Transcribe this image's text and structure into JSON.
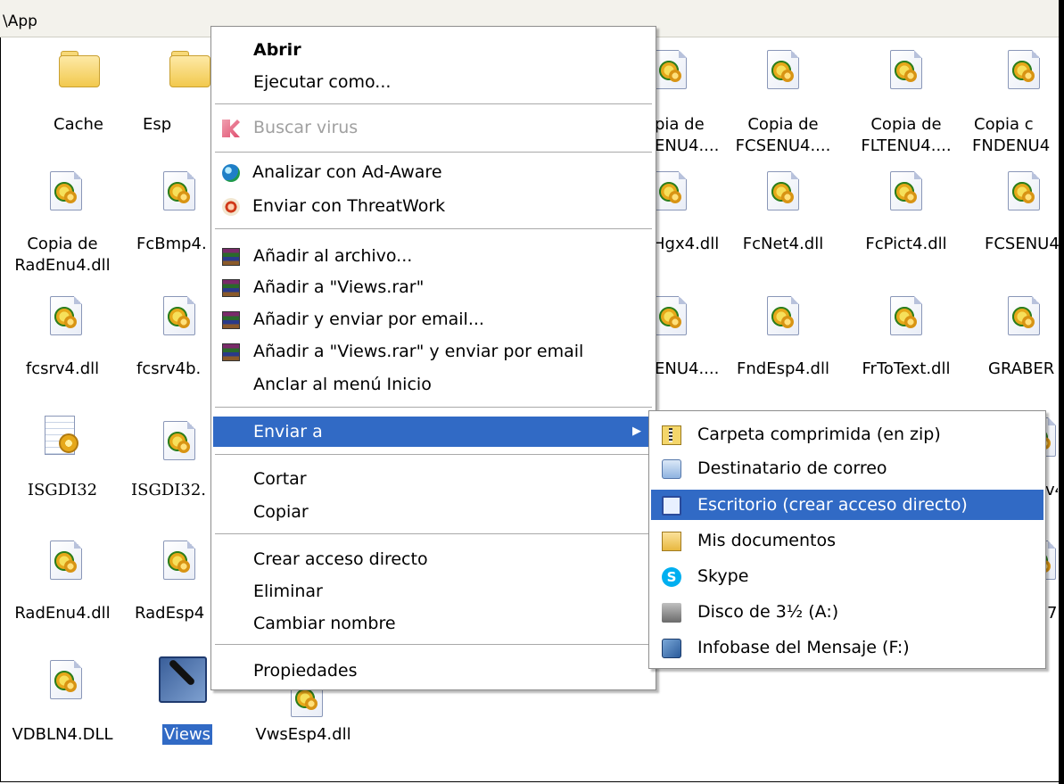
{
  "window": {
    "path": "\\App"
  },
  "icons": [
    {
      "label": "Cache",
      "type": "folder"
    },
    {
      "label": "Esp",
      "type": "folder"
    },
    {
      "label": "Copia de RadEnu4.dll",
      "line1": "Copia de",
      "line2": "RadEnu4.dll",
      "type": "dll"
    },
    {
      "label": "FcBmp4.",
      "type": "dll"
    },
    {
      "label": "fcsrv4.dll",
      "type": "dll"
    },
    {
      "label": "fcsrv4b.",
      "type": "dll"
    },
    {
      "label": "ISGDI32",
      "type": "notepad"
    },
    {
      "label": "ISGDI32.",
      "type": "dll"
    },
    {
      "label": "RadEnu4.dll",
      "type": "dll"
    },
    {
      "label": "RadEsp4",
      "type": "dll"
    },
    {
      "label": "VDBLN4.DLL",
      "type": "dll"
    },
    {
      "label": "Views",
      "type": "views",
      "selected": true
    },
    {
      "label": "VwsEsp4.dll",
      "type": "dll"
    },
    {
      "label": "pia de ENU4....",
      "line1": "pia de",
      "line2": "ENU4....",
      "type": "dll"
    },
    {
      "label": "Copia de FCSENU4....",
      "line1": "Copia de",
      "line2": "FCSENU4....",
      "type": "dll"
    },
    {
      "label": "Copia de FLTENU4....",
      "line1": "Copia de",
      "line2": "FLTENU4....",
      "type": "dll"
    },
    {
      "label": "Copia c FNDENU4",
      "line1": "Copia c",
      "line2": "FNDENU4",
      "type": "dll"
    },
    {
      "label": "Hgx4.dll",
      "type": "dll"
    },
    {
      "label": "FcNet4.dll",
      "type": "dll"
    },
    {
      "label": "FcPict4.dll",
      "type": "dll"
    },
    {
      "label": "FCSENU4",
      "type": "dll"
    },
    {
      "label": "ENU4....",
      "type": "dll"
    },
    {
      "label": "FndEsp4.dll",
      "type": "dll"
    },
    {
      "label": "FrToText.dll",
      "type": "dll"
    },
    {
      "label": "GRABER",
      "type": "dll"
    },
    {
      "label": "v4.",
      "type": "dll"
    },
    {
      "label": "7.",
      "type": "dll"
    }
  ],
  "context_menu": {
    "items": [
      {
        "label": "Abrir",
        "icon": "none",
        "bold": true
      },
      {
        "label": "Ejecutar como...",
        "icon": "none"
      },
      {
        "label": "Buscar virus",
        "icon": "kaspersky-icon",
        "disabled": true
      },
      {
        "label": "Analizar con Ad-Aware",
        "icon": "adaware-icon"
      },
      {
        "label": "Enviar con ThreatWork",
        "icon": "threatwork-icon"
      },
      {
        "label": "Añadir al archivo...",
        "icon": "winrar-icon"
      },
      {
        "label": "Añadir a \"Views.rar\"",
        "icon": "winrar-icon"
      },
      {
        "label": "Añadir y enviar por email...",
        "icon": "winrar-icon"
      },
      {
        "label": "Añadir a \"Views.rar\" y enviar por email",
        "icon": "winrar-icon"
      },
      {
        "label": "Anclar al menú Inicio",
        "icon": "none"
      },
      {
        "label": "Enviar a",
        "icon": "none",
        "highlighted": true,
        "submenu_arrow": "▶"
      },
      {
        "label": "Cortar",
        "icon": "none"
      },
      {
        "label": "Copiar",
        "icon": "none"
      },
      {
        "label": "Crear acceso directo",
        "icon": "none"
      },
      {
        "label": "Eliminar",
        "icon": "none"
      },
      {
        "label": "Cambiar nombre",
        "icon": "none"
      },
      {
        "label": "Propiedades",
        "icon": "none"
      }
    ]
  },
  "send_to_menu": {
    "items": [
      {
        "label": "Carpeta comprimida (en zip)",
        "icon": "zip-folder-icon"
      },
      {
        "label": "Destinatario de correo",
        "icon": "mail-recipient-icon"
      },
      {
        "label": "Escritorio (crear acceso directo)",
        "icon": "desktop-shortcut-icon",
        "highlighted": true
      },
      {
        "label": "Mis documentos",
        "icon": "my-documents-icon"
      },
      {
        "label": "Skype",
        "icon": "skype-icon",
        "glyph": "S"
      },
      {
        "label": "Disco de 3½ (A:)",
        "icon": "floppy-drive-icon"
      },
      {
        "label": "Infobase del Mensaje (F:)",
        "icon": "drive-icon"
      }
    ]
  },
  "colors": {
    "highlight": "#316ac5",
    "highlight_text": "#ffffff",
    "disabled_text": "#a0a0a0",
    "path_bar": "#f3f2ec"
  }
}
